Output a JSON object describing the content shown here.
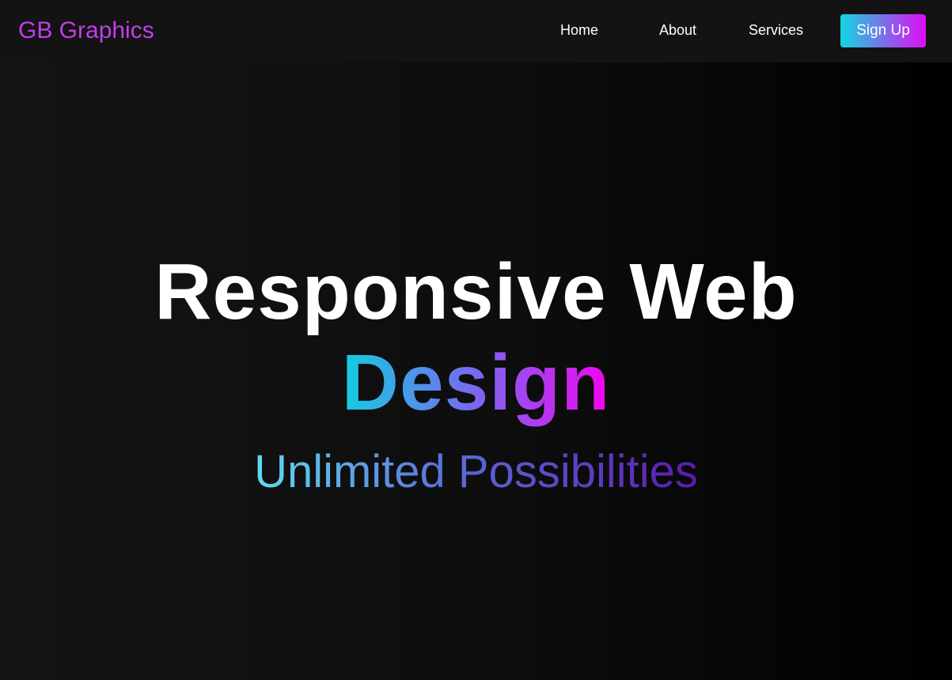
{
  "brand": {
    "logo_text": "GB Graphics",
    "logo_color": "#c13ee6"
  },
  "nav": {
    "items": [
      {
        "label": "Home"
      },
      {
        "label": "About"
      },
      {
        "label": "Services"
      }
    ],
    "signup_label": "Sign Up",
    "signup_gradient": [
      "#10d7e2",
      "#e10cf2"
    ]
  },
  "hero": {
    "title_line1": "Responsive Web",
    "title_line2": "Design",
    "subtitle": "Unlimited Possibilities",
    "title_gradient": [
      "#13cde0",
      "#7a67f0",
      "#f205f0"
    ],
    "subtitle_gradient": [
      "#61dbf1",
      "#5b6bd8",
      "#5c1aae"
    ]
  },
  "colors": {
    "navbar_bg": "#131313",
    "hero_bg_left": "#141414",
    "hero_bg_right": "#000000"
  }
}
